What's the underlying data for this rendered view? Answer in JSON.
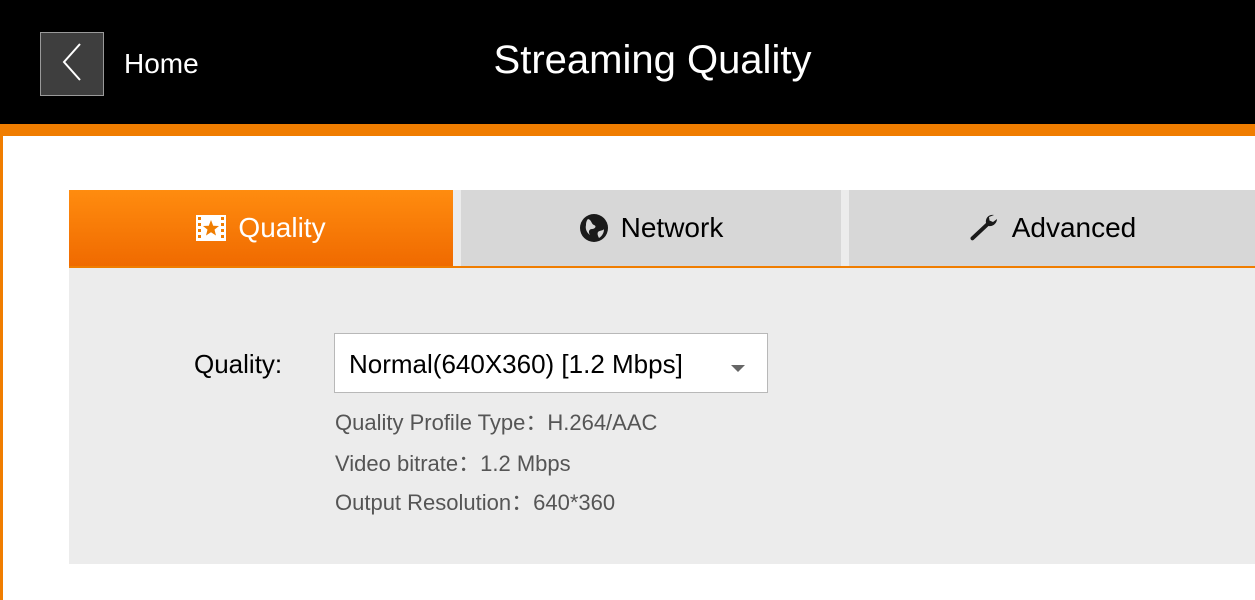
{
  "header": {
    "home_label": "Home",
    "title": "Streaming Quality"
  },
  "tabs": [
    {
      "label": "Quality",
      "icon": "film-star-icon",
      "active": true
    },
    {
      "label": "Network",
      "icon": "globe-icon",
      "active": false
    },
    {
      "label": "Advanced",
      "icon": "wrench-icon",
      "active": false
    }
  ],
  "quality": {
    "label": "Quality:",
    "selected": "Normal(640X360) [1.2 Mbps]",
    "profile_type": "Quality Profile Type：H.264/AAC",
    "video_bitrate": "Video bitrate：1.2 Mbps",
    "output_resolution": "Output Resolution：640*360"
  },
  "colors": {
    "accent": "#f07d00",
    "header_bg": "#000000",
    "panel_bg": "#ececec",
    "tab_inactive_bg": "#d7d7d7"
  }
}
